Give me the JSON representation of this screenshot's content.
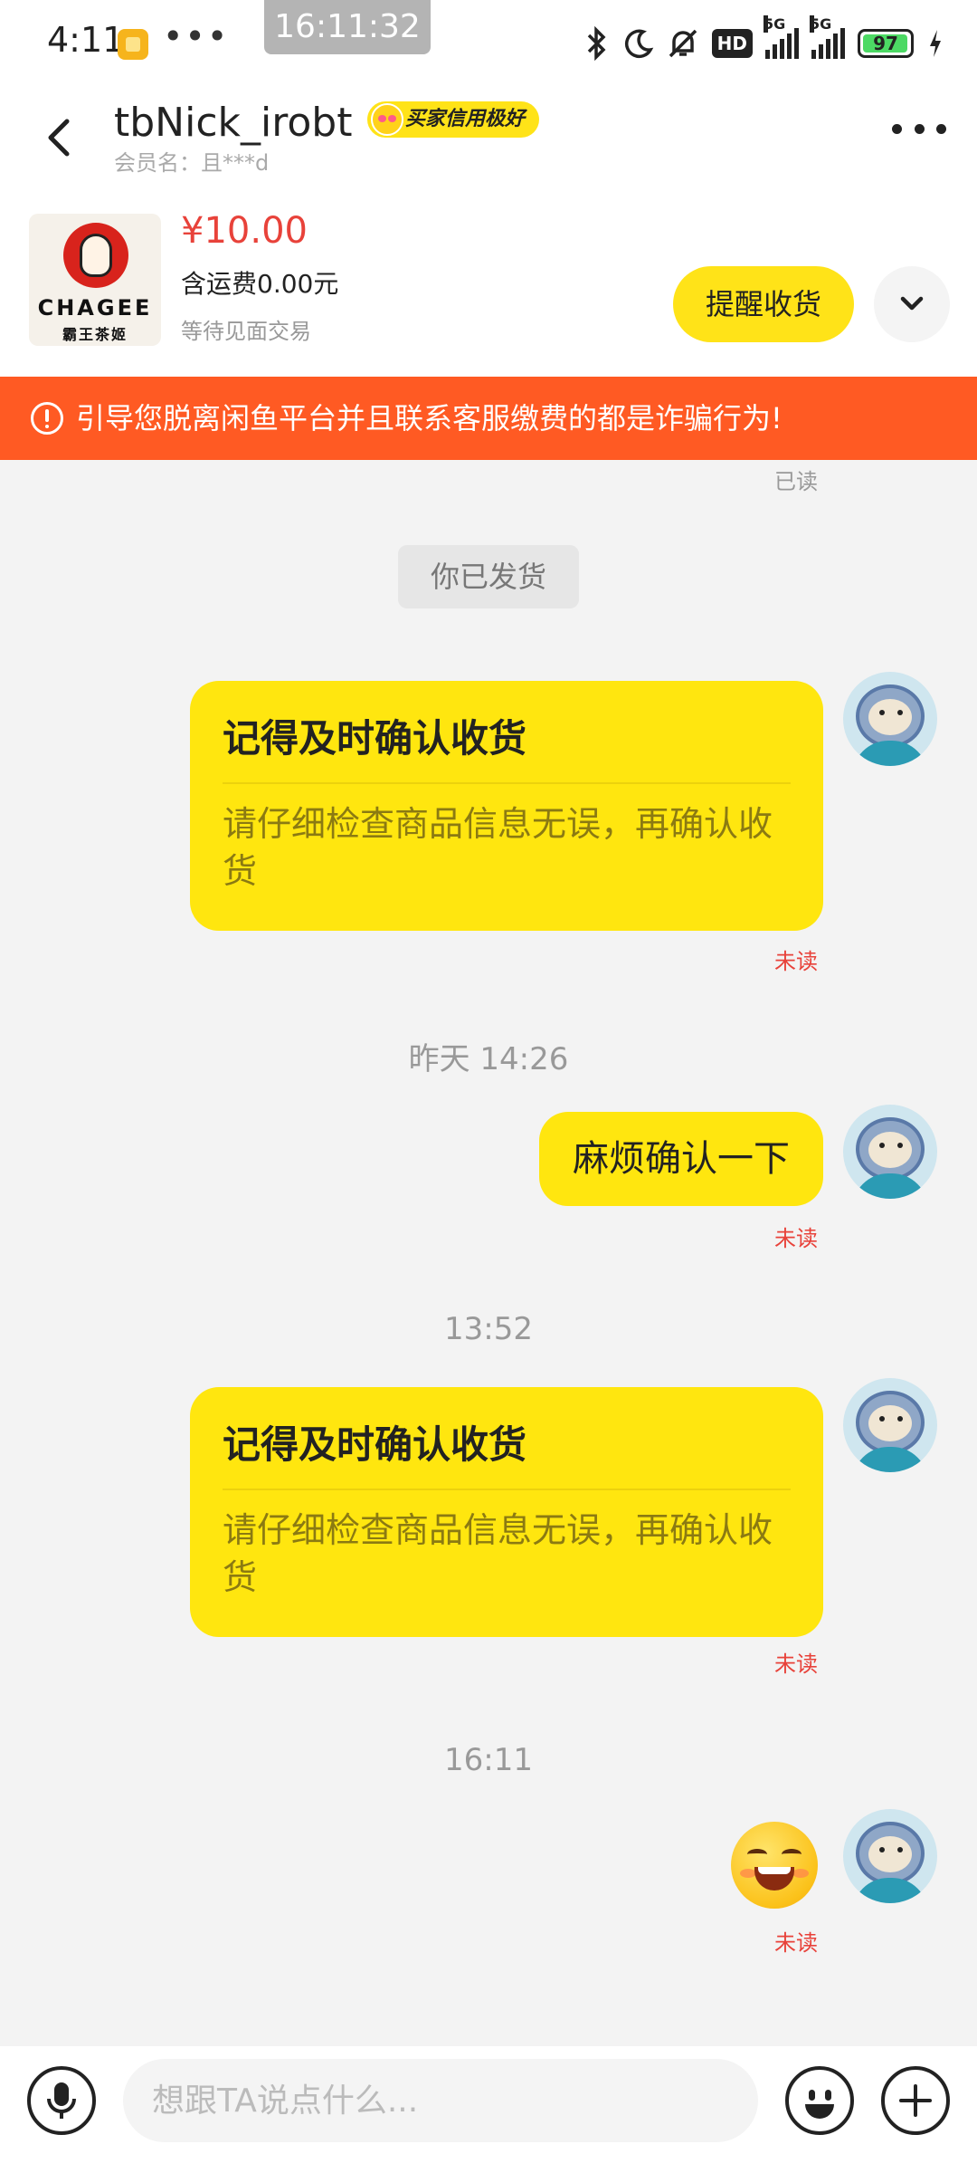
{
  "status_bar": {
    "time": "4:11",
    "more": "•••",
    "clock_overlay": "16:11:32",
    "network_1": "5G",
    "network_2": "5G",
    "hd_label": "HD",
    "battery_percent": "97",
    "battery_level": 0.97,
    "icons": [
      "bluetooth-icon",
      "moon-icon",
      "bell-muted-icon",
      "hd-icon",
      "signal-icon",
      "signal-icon",
      "battery-icon",
      "charging-icon"
    ]
  },
  "header": {
    "user_name": "tbNick_irobt",
    "credit_badge": "买家信用极好",
    "member_label": "会员名：且***d"
  },
  "product": {
    "brand": "CHAGEE",
    "brand_cn": "霸王茶姬",
    "price": "¥10.00",
    "shipping": "含运费0.00元",
    "status": "等待见面交易",
    "remind_button": "提醒收货"
  },
  "warning": {
    "text": "引导您脱离闲鱼平台并且联系客服缴费的都是诈骗行为!"
  },
  "messages": {
    "read_label": "已读",
    "system_notice": "你已发货",
    "card1": {
      "title": "记得及时确认收货",
      "body": "请仔细检查商品信息无误，再确认收货",
      "status": "未读"
    },
    "time_1": "昨天 14:26",
    "text1": {
      "text": "麻烦确认一下",
      "status": "未读"
    },
    "time_2": "13:52",
    "card2": {
      "title": "记得及时确认收货",
      "body": "请仔细检查商品信息无误，再确认收货",
      "status": "未读"
    },
    "time_3": "16:11",
    "emoji": {
      "status": "未读",
      "icon": "grinning-face-emoji"
    }
  },
  "input_bar": {
    "placeholder": "想跟TA说点什么..."
  },
  "colors": {
    "accent_yellow": "#ffe60f",
    "warning_orange": "#ff5a23",
    "price_red": "#e8423a"
  }
}
